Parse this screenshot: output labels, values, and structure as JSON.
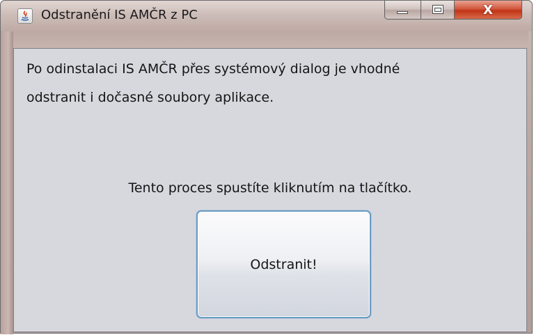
{
  "window": {
    "title": "Odstranění IS AMČR z PC",
    "icon": "java-icon",
    "controls": {
      "minimize_icon": "minimize-icon",
      "maximize_icon": "maximize-icon",
      "close_label": "X"
    }
  },
  "content": {
    "message_line1": "Po odinstalaci IS AMČR přes systémový dialog je vhodné",
    "message_line2": "odstranit i dočasné soubory aplikace.",
    "prompt": "Tento proces spustíte kliknutím na tlačítko.",
    "action_button_label": "Odstranit!"
  },
  "colors": {
    "client_background": "#d7d8de",
    "button_border": "#6a9cc4",
    "close_button": "#c63d1d"
  }
}
